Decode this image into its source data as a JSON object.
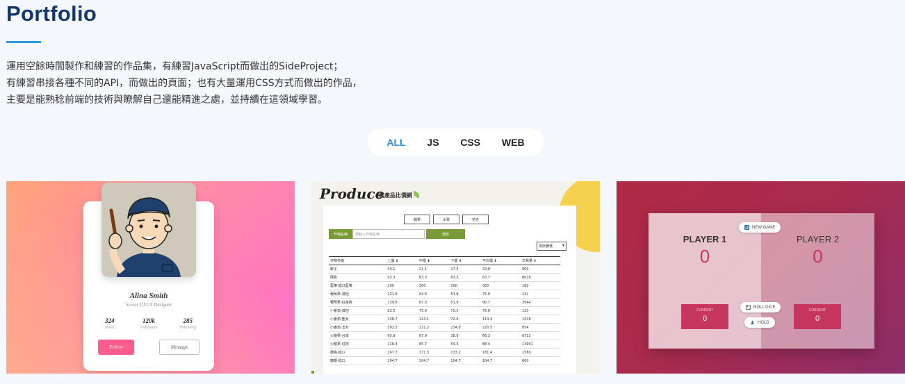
{
  "page": {
    "title": "Portfolio",
    "intro": [
      "運用空餘時間製作和練習的作品集，有練習JavaScript而做出的SideProject；",
      "有練習串接各種不同的API，而做出的頁面；也有大量運用CSS方式而做出的作品，",
      "主要是能熟稔前端的技術與瞭解自己還能精進之處，並持續在這領域學習。"
    ]
  },
  "filters": [
    {
      "label": "ALL",
      "active": true
    },
    {
      "label": "JS",
      "active": false
    },
    {
      "label": "CSS",
      "active": false
    },
    {
      "label": "WEB",
      "active": false
    }
  ],
  "profile_card": {
    "name": "Alina Smith",
    "role": "Senior UI/UX Designer",
    "stats": [
      {
        "value": "324",
        "label": "Posts"
      },
      {
        "value": "120k",
        "label": "Followers"
      },
      {
        "value": "285",
        "label": "Following"
      }
    ],
    "follow_label": "Follow",
    "message_label": "Message",
    "accent": "#ff5b8d"
  },
  "produce_card": {
    "logo": "Produce",
    "subtitle": "農產品比價網",
    "tabs": [
      "蔬果",
      "水果",
      "花卉"
    ],
    "search_label": "作物名稱",
    "search_placeholder": "請輸入作物名稱",
    "search_button": "搜尋",
    "sort_label": "排序篩選",
    "headers": [
      "作物名稱",
      "上價 ⬍",
      "中價 ⬍",
      "下價 ⬍",
      "平均價 ⬍",
      "交易量 ⬍"
    ],
    "rows": [
      [
        "椰子",
        "39.1",
        "21.1",
        "17.4",
        "23.8",
        "969"
      ],
      [
        "硬質",
        "93.3",
        "83.3",
        "83.3",
        "83.7",
        "8028"
      ],
      [
        "藍莓-進口藍莓",
        "300",
        "300",
        "300",
        "300",
        "180"
      ],
      [
        "葡萄果-其他",
        "121.8",
        "64.8",
        "53.8",
        "75.8",
        "141"
      ],
      [
        "葡萄果-紅羌桃",
        "139.8",
        "87.3",
        "51.8",
        "90.7",
        "3544"
      ],
      [
        "小番茄-其他",
        "82.5",
        "75.9",
        "72.5",
        "76.8",
        "120"
      ],
      [
        "小番茄-聖女",
        "148.7",
        "113.1",
        "72.8",
        "113.3",
        "1418"
      ],
      [
        "小番茄-玉女",
        "392.2",
        "221.2",
        "134.8",
        "220.5",
        "854"
      ],
      [
        "火龍果-台灣",
        "93.9",
        "67.9",
        "38.9",
        "66.3",
        "6713"
      ],
      [
        "火龍果-紅肉",
        "118.4",
        "85.7",
        "54.3",
        "88.4",
        "13991"
      ],
      [
        "櫻桃-進口",
        "267.7",
        "171.3",
        "133.2",
        "181.4",
        "1580"
      ],
      [
        "龍眼-進口",
        "104.7",
        "104.7",
        "104.7",
        "104.7",
        "600"
      ]
    ],
    "accent": "#7a9a36"
  },
  "dice_card": {
    "new_game": "NEW GAME",
    "roll_dice": "ROLL DICE",
    "hold": "HOLD",
    "players": [
      {
        "name": "PLAYER 1",
        "score": "0",
        "current_label": "CURRENT",
        "current": "0"
      },
      {
        "name": "PLAYER 2",
        "score": "0",
        "current_label": "CURRENT",
        "current": "0"
      }
    ],
    "accent": "#c7365f"
  }
}
